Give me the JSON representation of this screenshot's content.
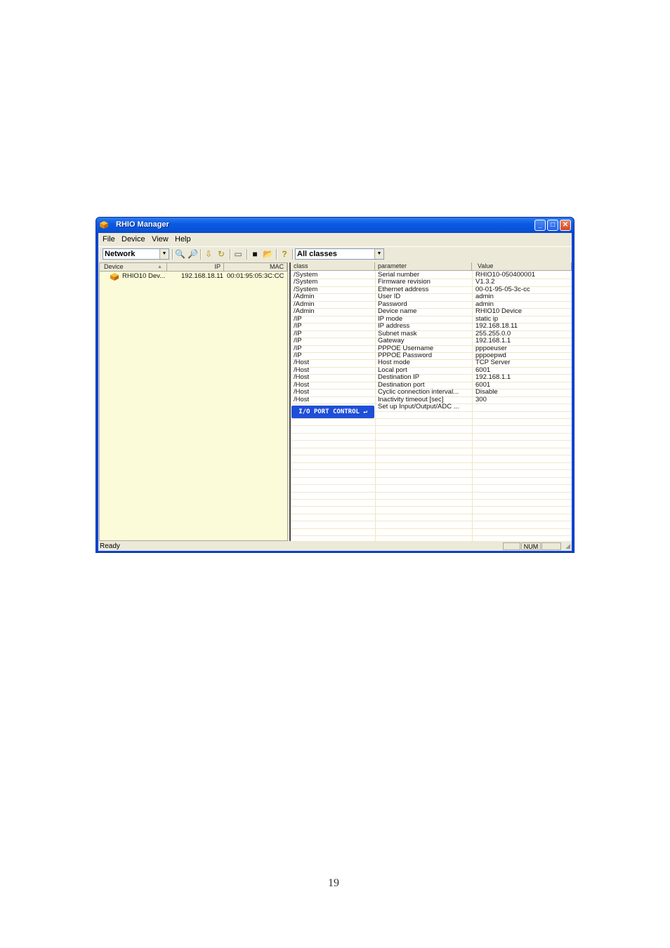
{
  "window": {
    "title": "RHIO Manager",
    "controls": {
      "minimize": "_",
      "maximize": "□",
      "close": "✕"
    }
  },
  "menu": [
    "File",
    "Device",
    "View",
    "Help"
  ],
  "toolbar": {
    "network_combo": "Network",
    "class_combo": "All classes",
    "icons": [
      "search-device-icon",
      "find-icon",
      "download-icon",
      "refresh-icon",
      "print-icon",
      "save-icon",
      "open-folder-icon",
      "help-icon"
    ]
  },
  "device_list": {
    "columns": [
      "Device",
      "IP",
      "MAC"
    ],
    "rows": [
      {
        "device": "RHIO10 Dev...",
        "ip": "192.168.18.11",
        "mac": "00:01:95:05:3C:CC"
      }
    ]
  },
  "param_table": {
    "columns": [
      "class",
      "parameter",
      "Value"
    ],
    "rows": [
      {
        "class": "/System",
        "parameter": "Serial number",
        "value": "RHIO10-050400001"
      },
      {
        "class": "/System",
        "parameter": "Firmware revision",
        "value": "V1.3.2"
      },
      {
        "class": "/System",
        "parameter": "Ethernet address",
        "value": "00-01-95-05-3c-cc"
      },
      {
        "class": "/Admin",
        "parameter": "User ID",
        "value": "admin"
      },
      {
        "class": "/Admin",
        "parameter": "Password",
        "value": "admin"
      },
      {
        "class": "/Admin",
        "parameter": "Device name",
        "value": "RHIO10 Device"
      },
      {
        "class": "/IP",
        "parameter": "IP mode",
        "value": "static ip"
      },
      {
        "class": "/IP",
        "parameter": "IP address",
        "value": "192.168.18.11"
      },
      {
        "class": "/IP",
        "parameter": "Subnet  mask",
        "value": "255.255.0.0"
      },
      {
        "class": "/IP",
        "parameter": "Gateway",
        "value": "192.168.1.1"
      },
      {
        "class": "/IP",
        "parameter": "PPPOE Username",
        "value": "pppoeuser"
      },
      {
        "class": "/IP",
        "parameter": "PPPOE Password",
        "value": "pppoepwd"
      },
      {
        "class": "/Host",
        "parameter": "Host mode",
        "value": "TCP Server"
      },
      {
        "class": "/Host",
        "parameter": "Local port",
        "value": "6001"
      },
      {
        "class": "/Host",
        "parameter": "Destination IP",
        "value": "192.168.1.1"
      },
      {
        "class": "/Host",
        "parameter": "Destination port",
        "value": "6001"
      },
      {
        "class": "/Host",
        "parameter": "Cyclic connection interval...",
        "value": "Disable"
      },
      {
        "class": "/Host",
        "parameter": "Inactivity timeout [sec]",
        "value": "300"
      },
      {
        "class": "",
        "parameter": "Set up Input/Output/ADC ...",
        "value": ""
      }
    ],
    "io_button": "I/O PORT CONTROL ↵"
  },
  "status_bar": {
    "text": "Ready",
    "num": "NUM"
  },
  "page_number": "19"
}
